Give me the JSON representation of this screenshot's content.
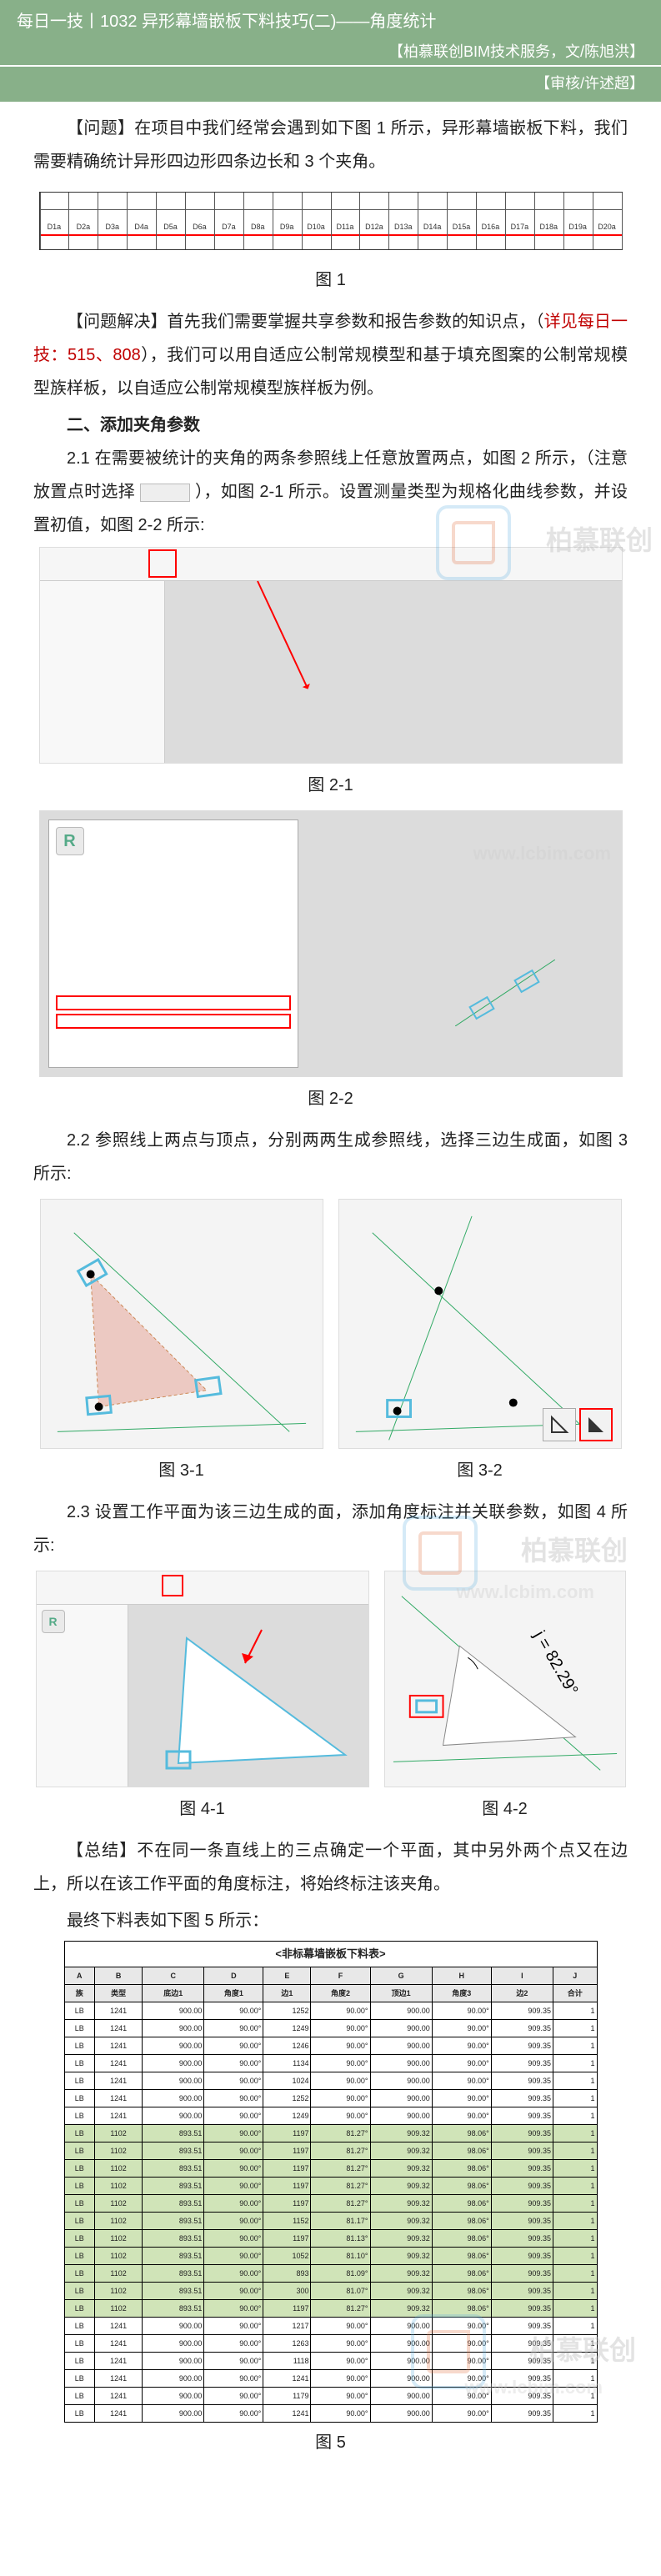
{
  "header": {
    "title": "每日一技丨1032  异形幕墙嵌板下料技巧(二)——角度统计",
    "author_line": "【柏慕联创BIM技术服务，文/陈旭洪】",
    "review_line": "【审核/许述超】"
  },
  "watermark": {
    "text": "柏慕联创",
    "url": "www.lcbim.com"
  },
  "p_problem": "【问题】在项目中我们经常会遇到如下图 1 所示，异形幕墙嵌板下料，我们需要精确统计异形四边形四条边长和 3 个夹角。",
  "cap_fig1": "图 1",
  "p_solve_a": "【问题解决】首先我们需要掌握共享参数和报告参数的知识点，（",
  "p_solve_link": "详见每日一技：515、808",
  "p_solve_b": "），我们可以用自适应公制常规模型和基于填充图案的公制常规模型族样板，以自适应公制常规模型族样板为例。",
  "h2_add": "二、添加夹角参数",
  "p_21": "2.1 在需要被统计的夹角的两条参照线上任意放置两点，如图 2 所示，（注意放置点时选择",
  "p_21b": "），如图 2-1 所示。设置测量类型为规格化曲线参数，并设置初值，如图 2-2 所示:",
  "cap_fig21": "图 2-1",
  "cap_fig22": "图 2-2",
  "p_22": "2.2 参照线上两点与顶点，分别两两生成参照线，选择三边生成面，如图 3 所示:",
  "cap_fig31": "图 3-1",
  "cap_fig32": "图 3-2",
  "p_23": "2.3 设置工作平面为该三边生成的面，添加角度标注并关联参数，如图 4 所示:",
  "cap_fig41": "图 4-1",
  "cap_fig42": "图 4-2",
  "angle_value": "j = 82.29°",
  "p_summary": "【总结】不在同一条直线上的三点确定一个平面，其中另外两个点又在边上，所以在该工作平面的角度标注，将始终标注该夹角。",
  "p_final": "最终下料表如下图 5 所示：",
  "cap_fig5": "图 5",
  "fig1_labels": [
    "D1a",
    "D2a",
    "D3a",
    "D4a",
    "D5a",
    "D6a",
    "D7a",
    "D8a",
    "D9a",
    "D10a",
    "D11a",
    "D12a",
    "D13a",
    "D14a",
    "D15a",
    "D16a",
    "D17a",
    "D18a",
    "D19a",
    "D20a"
  ],
  "fig5": {
    "title": "<非标幕墙嵌板下料表>",
    "head_letters": [
      "A",
      "B",
      "C",
      "D",
      "E",
      "F",
      "G",
      "H",
      "I",
      "J"
    ],
    "head_labels": [
      "族",
      "类型",
      "底边1",
      "角度1",
      "边1",
      "角度2",
      "顶边1",
      "角度3",
      "边2",
      "合计"
    ],
    "rows": [
      {
        "hl": false,
        "c": [
          "LB",
          "1241",
          "900.00",
          "90.00°",
          "1252",
          "90.00°",
          "900.00",
          "90.00°",
          "909.35",
          "1"
        ]
      },
      {
        "hl": false,
        "c": [
          "LB",
          "1241",
          "900.00",
          "90.00°",
          "1249",
          "90.00°",
          "900.00",
          "90.00°",
          "909.35",
          "1"
        ]
      },
      {
        "hl": false,
        "c": [
          "LB",
          "1241",
          "900.00",
          "90.00°",
          "1246",
          "90.00°",
          "900.00",
          "90.00°",
          "909.35",
          "1"
        ]
      },
      {
        "hl": false,
        "c": [
          "LB",
          "1241",
          "900.00",
          "90.00°",
          "1134",
          "90.00°",
          "900.00",
          "90.00°",
          "909.35",
          "1"
        ]
      },
      {
        "hl": false,
        "c": [
          "LB",
          "1241",
          "900.00",
          "90.00°",
          "1024",
          "90.00°",
          "900.00",
          "90.00°",
          "909.35",
          "1"
        ]
      },
      {
        "hl": false,
        "c": [
          "LB",
          "1241",
          "900.00",
          "90.00°",
          "1252",
          "90.00°",
          "900.00",
          "90.00°",
          "909.35",
          "1"
        ]
      },
      {
        "hl": false,
        "c": [
          "LB",
          "1241",
          "900.00",
          "90.00°",
          "1249",
          "90.00°",
          "900.00",
          "90.00°",
          "909.35",
          "1"
        ]
      },
      {
        "hl": true,
        "c": [
          "LB",
          "1102",
          "893.51",
          "90.00°",
          "1197",
          "81.27°",
          "909.32",
          "98.06°",
          "909.35",
          "1"
        ]
      },
      {
        "hl": true,
        "c": [
          "LB",
          "1102",
          "893.51",
          "90.00°",
          "1197",
          "81.27°",
          "909.32",
          "98.06°",
          "909.35",
          "1"
        ]
      },
      {
        "hl": true,
        "c": [
          "LB",
          "1102",
          "893.51",
          "90.00°",
          "1197",
          "81.27°",
          "909.32",
          "98.06°",
          "909.35",
          "1"
        ]
      },
      {
        "hl": true,
        "c": [
          "LB",
          "1102",
          "893.51",
          "90.00°",
          "1197",
          "81.27°",
          "909.32",
          "98.06°",
          "909.35",
          "1"
        ]
      },
      {
        "hl": true,
        "c": [
          "LB",
          "1102",
          "893.51",
          "90.00°",
          "1197",
          "81.27°",
          "909.32",
          "98.06°",
          "909.35",
          "1"
        ]
      },
      {
        "hl": true,
        "c": [
          "LB",
          "1102",
          "893.51",
          "90.00°",
          "1152",
          "81.17°",
          "909.32",
          "98.06°",
          "909.35",
          "1"
        ]
      },
      {
        "hl": true,
        "c": [
          "LB",
          "1102",
          "893.51",
          "90.00°",
          "1197",
          "81.13°",
          "909.32",
          "98.06°",
          "909.35",
          "1"
        ]
      },
      {
        "hl": true,
        "c": [
          "LB",
          "1102",
          "893.51",
          "90.00°",
          "1052",
          "81.10°",
          "909.32",
          "98.06°",
          "909.35",
          "1"
        ]
      },
      {
        "hl": true,
        "c": [
          "LB",
          "1102",
          "893.51",
          "90.00°",
          "893",
          "81.09°",
          "909.32",
          "98.06°",
          "909.35",
          "1"
        ]
      },
      {
        "hl": true,
        "c": [
          "LB",
          "1102",
          "893.51",
          "90.00°",
          "300",
          "81.07°",
          "909.32",
          "98.06°",
          "909.35",
          "1"
        ]
      },
      {
        "hl": true,
        "c": [
          "LB",
          "1102",
          "893.51",
          "90.00°",
          "1197",
          "81.27°",
          "909.32",
          "98.06°",
          "909.35",
          "1"
        ]
      },
      {
        "hl": false,
        "c": [
          "LB",
          "1241",
          "900.00",
          "90.00°",
          "1217",
          "90.00°",
          "900.00",
          "90.00°",
          "909.35",
          "1"
        ]
      },
      {
        "hl": false,
        "c": [
          "LB",
          "1241",
          "900.00",
          "90.00°",
          "1263",
          "90.00°",
          "900.00",
          "90.00°",
          "909.35",
          "1"
        ]
      },
      {
        "hl": false,
        "c": [
          "LB",
          "1241",
          "900.00",
          "90.00°",
          "1118",
          "90.00°",
          "900.00",
          "90.00°",
          "909.35",
          "1"
        ]
      },
      {
        "hl": false,
        "c": [
          "LB",
          "1241",
          "900.00",
          "90.00°",
          "1241",
          "90.00°",
          "900.00",
          "90.00°",
          "909.35",
          "1"
        ]
      },
      {
        "hl": false,
        "c": [
          "LB",
          "1241",
          "900.00",
          "90.00°",
          "1179",
          "90.00°",
          "900.00",
          "90.00°",
          "909.35",
          "1"
        ]
      },
      {
        "hl": false,
        "c": [
          "LB",
          "1241",
          "900.00",
          "90.00°",
          "1241",
          "90.00°",
          "900.00",
          "90.00°",
          "909.35",
          "1"
        ]
      }
    ]
  }
}
